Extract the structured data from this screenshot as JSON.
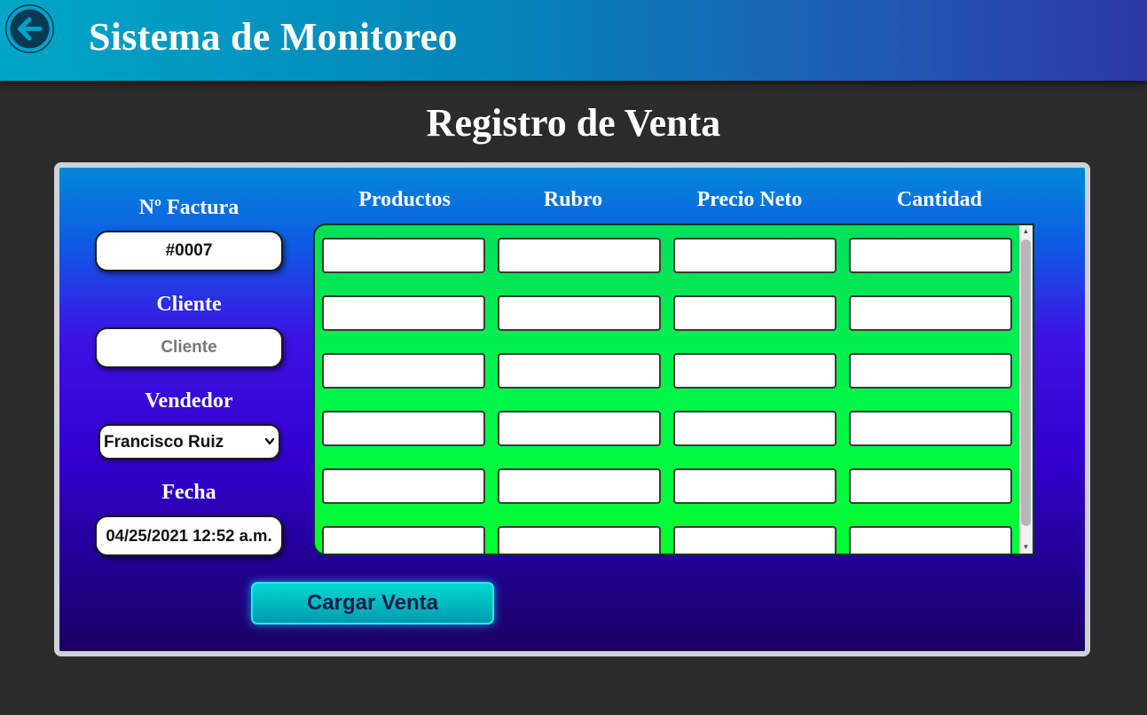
{
  "header": {
    "title": "Sistema de Monitoreo",
    "back_icon": "arrow-left-icon"
  },
  "page": {
    "title": "Registro de Venta"
  },
  "form": {
    "factura_label": "Nº Factura",
    "factura_value": "#0007",
    "cliente_label": "Cliente",
    "cliente_value": "",
    "cliente_placeholder": "Cliente",
    "vendedor_label": "Vendedor",
    "vendedor_selected": "Francisco Ruiz",
    "fecha_label": "Fecha",
    "fecha_value": "04/25/2021 12:52 a.m."
  },
  "table": {
    "columns": [
      "Productos",
      "Rubro",
      "Precio Neto",
      "Cantidad"
    ]
  },
  "actions": {
    "submit_label": "Cargar Venta"
  },
  "colors": {
    "header_start": "#00a6c6",
    "header_end": "#2d38a4",
    "grid_green": "#00ff33",
    "submit_cyan": "#00c8c8"
  }
}
